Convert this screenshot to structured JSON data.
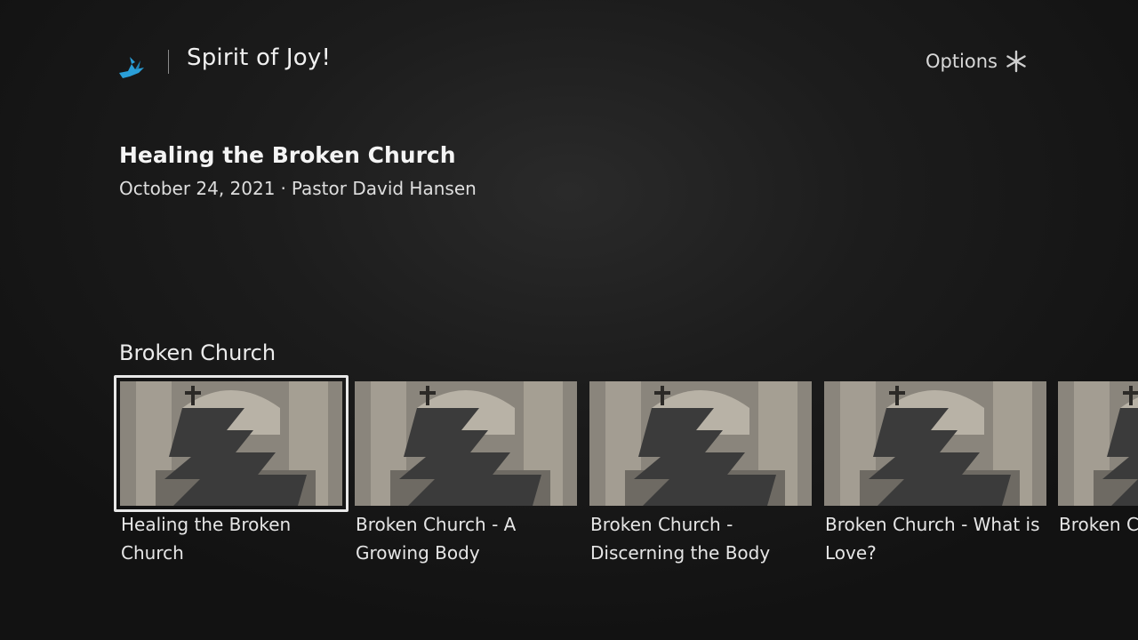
{
  "header": {
    "channel_title": "Spirit of Joy!",
    "logo_icon": "dove-icon",
    "options_label": "Options",
    "options_icon": "asterisk-icon"
  },
  "now_playing": {
    "title": "Healing the Broken Church",
    "date": "October 24, 2021",
    "separator": "·",
    "speaker": "Pastor David Hansen"
  },
  "row": {
    "title": "Broken Church",
    "items": [
      {
        "label": "Healing the Broken Church",
        "focused": true
      },
      {
        "label": "Broken Church - A Growing Body",
        "focused": false
      },
      {
        "label": "Broken Church - Discerning the Body",
        "focused": false
      },
      {
        "label": "Broken Church - What is Love?",
        "focused": false
      },
      {
        "label": "Broken C… more Ex…",
        "focused": false
      }
    ]
  },
  "colors": {
    "accent_blue": "#2a9fd8",
    "focus_ring": "#e8e8e8",
    "background": "#1c1c1c"
  }
}
